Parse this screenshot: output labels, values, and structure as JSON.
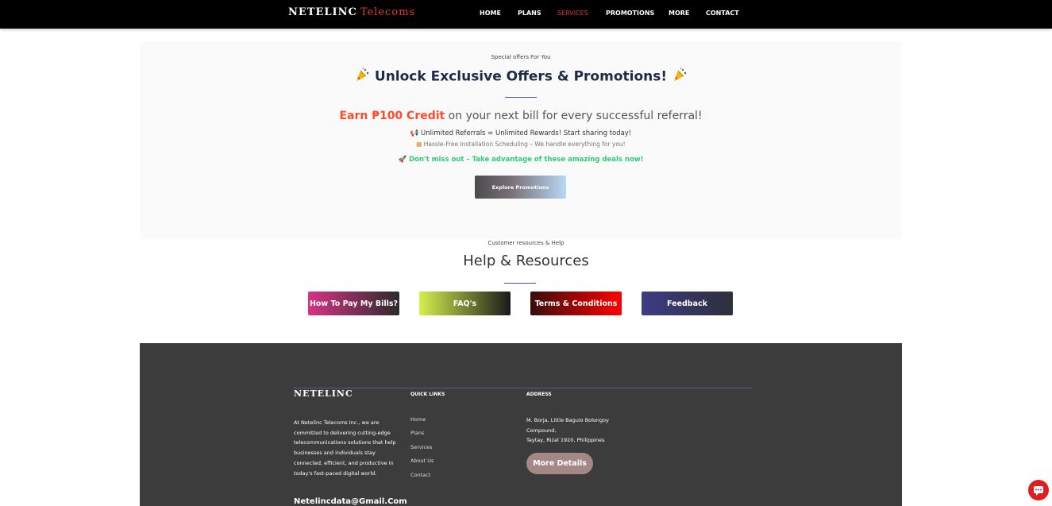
{
  "nav": {
    "brand": "NETELINC",
    "brand_accent": "Telecoms",
    "items": [
      {
        "label": "HOME"
      },
      {
        "label": "PLANS"
      },
      {
        "label": "SERVICES"
      },
      {
        "label": "PROMOTIONS"
      },
      {
        "label": "MORE"
      },
      {
        "label": "CONTACT"
      }
    ],
    "active_item": "SERVICES"
  },
  "promo": {
    "eyebrow": "Special offers For You",
    "title": "Unlock Exclusive Offers & Promotions!",
    "earn_highlight": "Earn ₱100 Credit",
    "earn_rest": " on your next bill for every successful referral!",
    "bullet1": "Unlimited Referrals = Unlimited Rewards! Start sharing today!",
    "bullet2": "Hassle-Free Installation Scheduling – We handle everything for you!",
    "cta_text": "Don't miss out – Take advantage of these amazing deals now!",
    "button": "Explore Promotions"
  },
  "help": {
    "eyebrow": "Customer resources & Help",
    "title": "Help & Resources",
    "buttons": [
      {
        "label": "How To Pay My Bills?"
      },
      {
        "label": "FAQ's"
      },
      {
        "label": "Terms & Conditions"
      },
      {
        "label": "Feedback"
      }
    ]
  },
  "footer": {
    "brand": "NETELINC",
    "about": "At Netelinc Telecoms Inc., we are committed to delivering cutting-edge telecommunications solutions that help businesses and individuals stay connected, efficient, and productive in today's fast-paced digital world.",
    "email": "Netelincdata@Gmail.Com",
    "quick_links_heading": "QUICK LINKS",
    "links": [
      {
        "label": "Home"
      },
      {
        "label": "Plans"
      },
      {
        "label": "Services"
      },
      {
        "label": "About Us"
      },
      {
        "label": "Contact"
      }
    ],
    "address_heading": "ADDRESS",
    "address_line1": "M. Borja, Little Baguio Bolongoy",
    "address_line2": "Compound,",
    "address_line3": "Taytay, Rizal 1920, Philippines",
    "more_button": "More Details"
  },
  "colors": {
    "accent_red": "#e53935",
    "earn_orange": "#ff4b2b",
    "success_green": "#2ecc71",
    "divider_blue": "#3f51b5",
    "footer_bg": "#3c3c3c"
  },
  "icons": [
    "party-popper-icon",
    "megaphone-icon",
    "calendar-icon",
    "rocket-icon",
    "chat-icon"
  ]
}
